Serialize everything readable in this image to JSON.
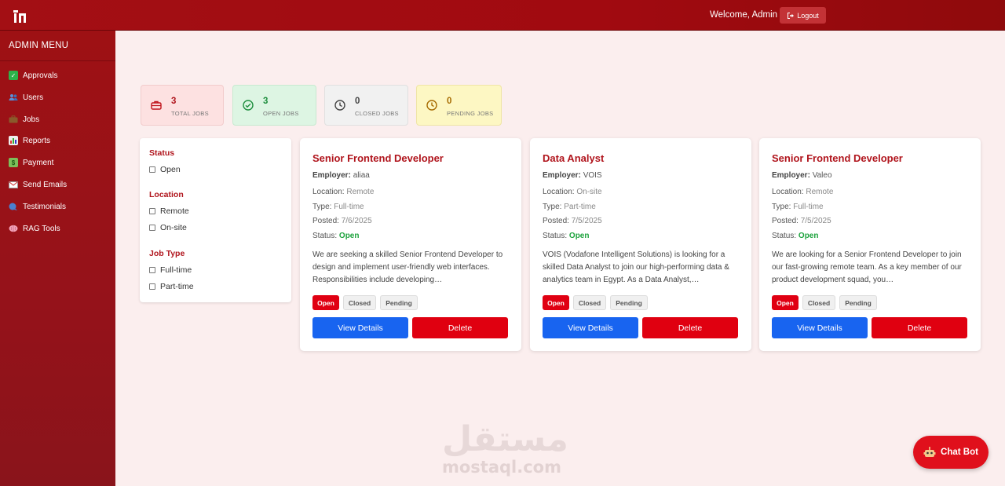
{
  "header": {
    "welcome": "Welcome, Admin",
    "logout_label": "Logout"
  },
  "sidebar": {
    "title": "ADMIN MENU",
    "items": [
      {
        "label": "Approvals",
        "icon": "check-box-icon"
      },
      {
        "label": "Users",
        "icon": "users-icon"
      },
      {
        "label": "Jobs",
        "icon": "briefcase-icon"
      },
      {
        "label": "Reports",
        "icon": "bar-chart-icon"
      },
      {
        "label": "Payment",
        "icon": "money-icon"
      },
      {
        "label": "Send Emails",
        "icon": "envelope-icon"
      },
      {
        "label": "Testimonials",
        "icon": "speech-icon"
      },
      {
        "label": "RAG Tools",
        "icon": "brain-icon"
      }
    ]
  },
  "stats": [
    {
      "value": "3",
      "label": "TOTAL JOBS",
      "color": "#b0141c",
      "bg": "#fde1e1"
    },
    {
      "value": "3",
      "label": "OPEN JOBS",
      "color": "#1e8e3e",
      "bg": "#ddf5e3"
    },
    {
      "value": "0",
      "label": "CLOSED JOBS",
      "color": "#444444",
      "bg": "#f1f1f1"
    },
    {
      "value": "0",
      "label": "PENDING JOBS",
      "color": "#a66a00",
      "bg": "#fdf7c3"
    }
  ],
  "filters": {
    "status_heading": "Status",
    "status_options": [
      "Open"
    ],
    "location_heading": "Location",
    "location_options": [
      "Remote",
      "On-site"
    ],
    "jobtype_heading": "Job Type",
    "jobtype_options": [
      "Full-time",
      "Part-time"
    ]
  },
  "labels": {
    "employer": "Employer:",
    "location": "Location:",
    "type": "Type:",
    "posted": "Posted:",
    "status": "Status:",
    "chip_open": "Open",
    "chip_closed": "Closed",
    "chip_pending": "Pending",
    "view_details": "View Details",
    "delete": "Delete"
  },
  "jobs": [
    {
      "title": "Senior Frontend Developer",
      "employer": "aliaa",
      "location": "Remote",
      "type": "Full-time",
      "posted": "7/6/2025",
      "status": "Open",
      "description": "We are seeking a skilled Senior Frontend Developer to design and implement user-friendly web interfaces. Responsibilities include developing…"
    },
    {
      "title": "Data Analyst",
      "employer": "VOIS",
      "location": "On-site",
      "type": "Part-time",
      "posted": "7/5/2025",
      "status": "Open",
      "description": "VOIS (Vodafone Intelligent Solutions) is looking for a skilled Data Analyst to join our high-performing data & analytics team in Egypt. As a Data Analyst,…"
    },
    {
      "title": "Senior Frontend Developer",
      "employer": "Valeo",
      "location": "Remote",
      "type": "Full-time",
      "posted": "7/5/2025",
      "status": "Open",
      "description": "We are looking for a Senior Frontend Developer to join our fast-growing remote team. As a key member of our product development squad, you…"
    }
  ],
  "watermark": {
    "arabic": "مستقل",
    "latin": "mostaql.com"
  },
  "chatbot": {
    "label": "Chat Bot",
    "icon": "robot-icon"
  }
}
